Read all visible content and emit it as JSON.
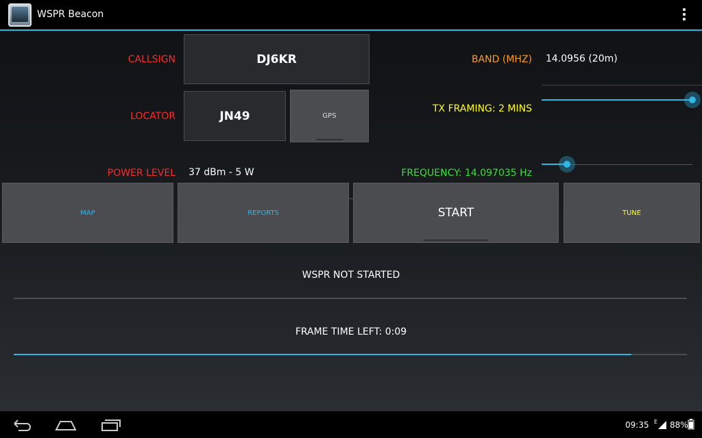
{
  "app": {
    "title": "WSPR Beacon"
  },
  "form": {
    "callsign_label": "CALLSIGN",
    "callsign_value": "DJ6KR",
    "locator_label": "LOCATOR",
    "locator_value": "JN49",
    "gps_label": "GPS",
    "power_label": "POWER LEVEL",
    "power_value": "37 dBm - 5 W",
    "band_label": "BAND (MHZ)",
    "band_value": "14.0956 (20m)",
    "tx_framing_label": "TX FRAMING: 2 MINS",
    "tx_framing_slider": 1.0,
    "frequency_label": "FREQUENCY: 14.097035 Hz",
    "frequency_slider": 0.17
  },
  "buttons": {
    "map": "MAP",
    "reports": "REPORTS",
    "start": "START",
    "tune": "TUNE"
  },
  "status": {
    "wspr": "WSPR NOT STARTED",
    "wspr_progress": 0,
    "frame_time": "FRAME TIME LEFT: 0:09",
    "frame_progress": 0.918
  },
  "system": {
    "clock": "09:35",
    "signal_tag": "E",
    "battery": "88%"
  },
  "colors": {
    "accent": "#33b5e5",
    "label_red": "#ff2a2a",
    "label_orange": "#ff9b1f",
    "label_yellow": "#ffff1c",
    "label_green": "#3be13a"
  }
}
